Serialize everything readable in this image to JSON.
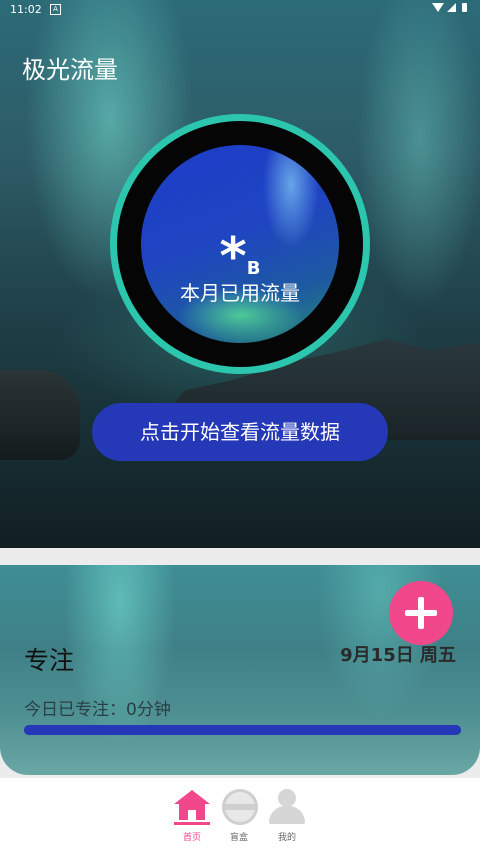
{
  "status_bar": {
    "time": "11:02",
    "notification_badge": "A"
  },
  "app": {
    "title": "极光流量"
  },
  "usage": {
    "value": "*",
    "unit": "B",
    "label": "本月已用流量"
  },
  "start_button": {
    "label": "点击开始查看流量数据"
  },
  "focus": {
    "title": "专注",
    "date": "9月15日 周五",
    "today_label": "今日已专注：0分钟",
    "progress_fraction": 1.0
  },
  "fab": {
    "icon": "plus-icon"
  },
  "bottom_nav": {
    "items": [
      {
        "label": "首页",
        "icon": "home-icon",
        "active": true
      },
      {
        "label": "盲盒",
        "icon": "blindbox-icon",
        "active": false
      },
      {
        "label": "我的",
        "icon": "user-icon",
        "active": false
      }
    ]
  },
  "colors": {
    "accent_pink": "#f1488b",
    "button_blue": "#2438b8",
    "ring_teal": "#2cc5ad"
  }
}
